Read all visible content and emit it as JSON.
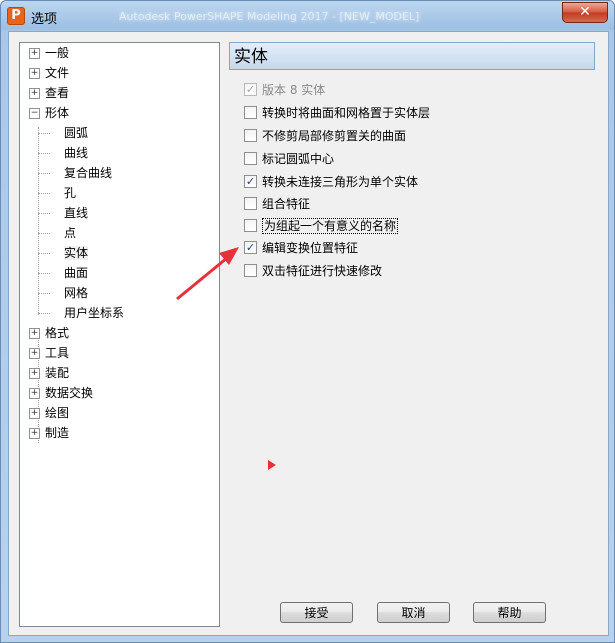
{
  "window": {
    "title": "选项",
    "background_title": "Autodesk PowerSHAPE Modeling 2017 - [NEW_MODEL]",
    "app_icon_letter": "P"
  },
  "tree": {
    "items": [
      {
        "label": "一般",
        "expander": "+"
      },
      {
        "label": "文件",
        "expander": "+"
      },
      {
        "label": "查看",
        "expander": "+"
      },
      {
        "label": "形体",
        "expander": "−",
        "children": [
          "圆弧",
          "曲线",
          "复合曲线",
          "孔",
          "直线",
          "点",
          "实体",
          "曲面",
          "网格",
          "用户坐标系"
        ]
      },
      {
        "label": "格式",
        "expander": "+"
      },
      {
        "label": "工具",
        "expander": "+"
      },
      {
        "label": "装配",
        "expander": "+"
      },
      {
        "label": "数据交换",
        "expander": "+"
      },
      {
        "label": "绘图",
        "expander": "+"
      },
      {
        "label": "制造",
        "expander": "+"
      }
    ],
    "selected": "实体"
  },
  "panel": {
    "title": "实体",
    "options": [
      {
        "label": "版本 8 实体",
        "checked": true,
        "disabled": true
      },
      {
        "label": "转换时将曲面和网格置于实体层",
        "checked": false
      },
      {
        "label": "不修剪局部修剪置关的曲面",
        "checked": false
      },
      {
        "label": "标记圆弧中心",
        "checked": false
      },
      {
        "label": "转换未连接三角形为单个实体",
        "checked": true
      },
      {
        "label": "组合特征",
        "checked": false
      },
      {
        "label": "为组起一个有意义的名称",
        "checked": false,
        "focused": true
      },
      {
        "label": "编辑变换位置特征",
        "checked": true
      },
      {
        "label": "双击特征进行快速修改",
        "checked": false
      }
    ]
  },
  "buttons": {
    "accept": "接受",
    "cancel": "取消",
    "help": "帮助"
  },
  "colors": {
    "annotation_arrow": "#e8303a",
    "check": "#1e3f8a"
  }
}
